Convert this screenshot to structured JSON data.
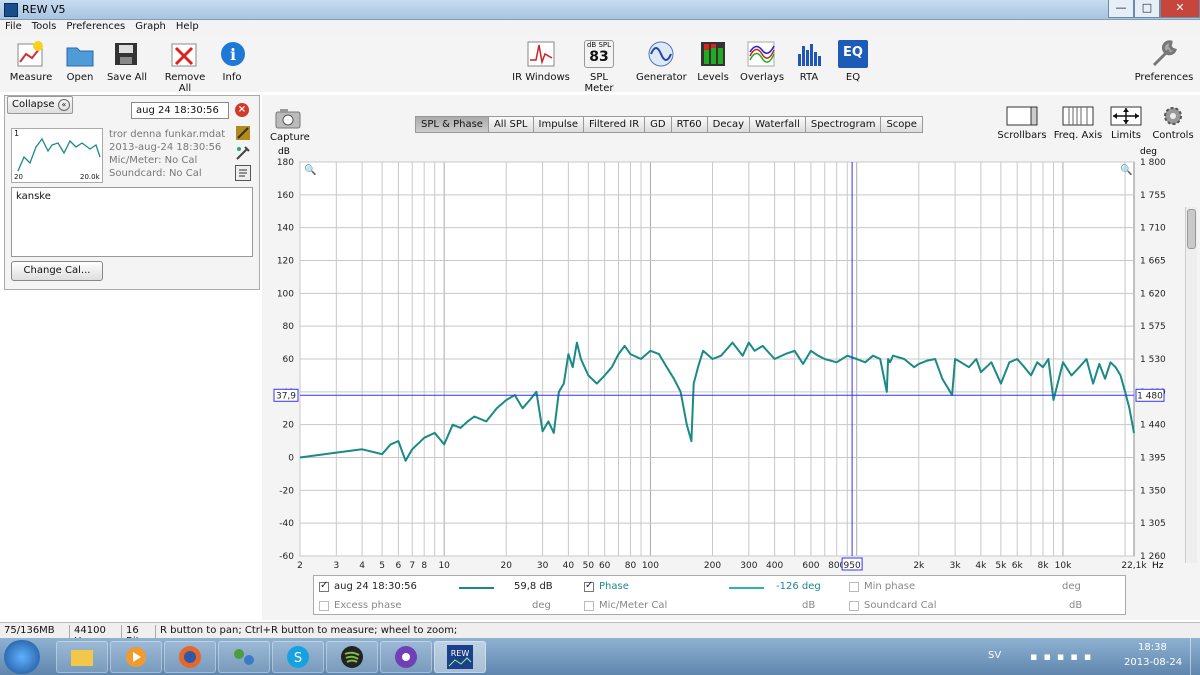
{
  "window": {
    "title": "REW V5",
    "controls": [
      "—",
      "□",
      "✕"
    ]
  },
  "menu": [
    "File",
    "Tools",
    "Preferences",
    "Graph",
    "Help"
  ],
  "toolbar_left": [
    "Measure",
    "Open",
    "Save All",
    "Remove All",
    "Info"
  ],
  "toolbar_mid": [
    "IR Windows",
    "SPL Meter",
    "Generator",
    "Levels",
    "Overlays",
    "RTA",
    "EQ"
  ],
  "spl_badge": {
    "top": "dB SPL",
    "value": "83"
  },
  "toolbar_right": "Preferences",
  "left_panel": {
    "collapse_label": "Collapse",
    "measurement_name": "aug 24 18:30:56",
    "thumb_index": "1",
    "thumb_left": "20",
    "thumb_right": "20.0k",
    "file": "tror denna funkar.mdat",
    "date": "2013-aug-24 18:30:56",
    "mic": "Mic/Meter: No Cal",
    "soundcard": "Soundcard: No Cal",
    "notes": "kanske",
    "change_cal": "Change Cal..."
  },
  "capture_label": "Capture",
  "tabs": [
    "SPL & Phase",
    "All SPL",
    "Impulse",
    "Filtered IR",
    "GD",
    "RT60",
    "Decay",
    "Waterfall",
    "Spectrogram",
    "Scope"
  ],
  "active_tab": 0,
  "right_controls": [
    "Scrollbars",
    "Freq. Axis",
    "Limits",
    "Controls"
  ],
  "legend": {
    "row1": [
      {
        "label": "aug 24 18:30:56",
        "value": "59,8 dB",
        "checked": true
      },
      {
        "label": "Phase",
        "value": "-126 deg",
        "checked": true
      },
      {
        "label": "Min phase",
        "value": "deg",
        "checked": false
      }
    ],
    "row2": [
      {
        "label": "Excess phase",
        "value": "deg",
        "checked": false
      },
      {
        "label": "Mic/Meter Cal",
        "value": "dB",
        "checked": false
      },
      {
        "label": "Soundcard Cal",
        "value": "dB",
        "checked": false
      }
    ]
  },
  "status": [
    "75/136MB",
    "44100 Hz",
    "16 Bit",
    "R button to pan; Ctrl+R button to measure; wheel to zoom;"
  ],
  "taskbar": {
    "lang": "SV",
    "time": "18:38",
    "date": "2013-08-24"
  },
  "colors": {
    "trace": "#1a8a87",
    "cursor": "#3333ff",
    "grid": "#c8c8c8"
  },
  "chart_data": {
    "type": "line",
    "xscale": "log",
    "xlim": [
      2,
      22100
    ],
    "ylim": [
      -60,
      180
    ],
    "y2lim": [
      1260,
      1800
    ],
    "ylabel": "dB",
    "y2label": "deg",
    "xunit": "Hz",
    "yticks": [
      180,
      160,
      140,
      120,
      100,
      80,
      60,
      40,
      20,
      0,
      -20,
      -40,
      -60
    ],
    "y2ticks": [
      "1 800",
      "1 755",
      "1 710",
      "1 665",
      "1 620",
      "1 575",
      "1 530",
      "1 480",
      "1 440",
      "1 395",
      "1 350",
      "1 305",
      "1 260"
    ],
    "xticks": [
      {
        "v": 2,
        "t": "2"
      },
      {
        "v": 3,
        "t": "3"
      },
      {
        "v": 4,
        "t": "4"
      },
      {
        "v": 5,
        "t": "5"
      },
      {
        "v": 6,
        "t": "6"
      },
      {
        "v": 7,
        "t": "7"
      },
      {
        "v": 8,
        "t": "8"
      },
      {
        "v": 10,
        "t": "10"
      },
      {
        "v": 20,
        "t": "20"
      },
      {
        "v": 30,
        "t": "30"
      },
      {
        "v": 40,
        "t": "40"
      },
      {
        "v": 50,
        "t": "50"
      },
      {
        "v": 60,
        "t": "60"
      },
      {
        "v": 80,
        "t": "80"
      },
      {
        "v": 100,
        "t": "100"
      },
      {
        "v": 200,
        "t": "200"
      },
      {
        "v": 300,
        "t": "300"
      },
      {
        "v": 400,
        "t": "400"
      },
      {
        "v": 600,
        "t": "600"
      },
      {
        "v": 800,
        "t": "800"
      },
      {
        "v": 2000,
        "t": "2k"
      },
      {
        "v": 3000,
        "t": "3k"
      },
      {
        "v": 4000,
        "t": "4k"
      },
      {
        "v": 5000,
        "t": "5k"
      },
      {
        "v": 6000,
        "t": "6k"
      },
      {
        "v": 8000,
        "t": "8k"
      },
      {
        "v": 10000,
        "t": "10k"
      },
      {
        "v": 22100,
        "t": "22,1k"
      }
    ],
    "cursor": {
      "x": 950,
      "x_label": "950",
      "y": 37.9,
      "y_label": "37,9",
      "y2_label": "1 480"
    },
    "series": [
      {
        "name": "aug 24 18:30:56",
        "x": [
          2,
          3,
          4,
          5,
          5.5,
          6,
          6.5,
          7,
          8,
          9,
          10,
          11,
          12,
          13,
          14,
          16,
          18,
          20,
          22,
          24,
          26,
          28,
          30,
          32,
          34,
          36,
          38,
          40,
          42,
          44,
          46,
          50,
          55,
          60,
          65,
          70,
          75,
          80,
          90,
          100,
          110,
          120,
          130,
          140,
          150,
          158,
          162,
          170,
          180,
          200,
          220,
          250,
          280,
          300,
          320,
          350,
          400,
          450,
          500,
          550,
          600,
          650,
          700,
          800,
          900,
          1000,
          1100,
          1200,
          1300,
          1400,
          1420,
          1450,
          1500,
          1700,
          1900,
          2000,
          2200,
          2400,
          2600,
          2900,
          3000,
          3200,
          3500,
          3800,
          4000,
          4500,
          5000,
          5500,
          6000,
          6500,
          7000,
          7500,
          8000,
          8500,
          9000,
          10000,
          11000,
          12000,
          13000,
          14000,
          15000,
          16000,
          17000,
          18000,
          19000,
          20000,
          21000,
          22100
        ],
        "y": [
          0,
          3,
          5,
          2,
          8,
          10,
          -2,
          5,
          12,
          15,
          8,
          20,
          18,
          22,
          25,
          22,
          30,
          35,
          38,
          30,
          35,
          40,
          16,
          22,
          15,
          40,
          45,
          63,
          55,
          70,
          60,
          50,
          45,
          50,
          55,
          63,
          68,
          63,
          60,
          65,
          63,
          55,
          48,
          40,
          20,
          10,
          45,
          55,
          65,
          60,
          62,
          70,
          62,
          70,
          65,
          68,
          60,
          63,
          65,
          57,
          65,
          62,
          60,
          58,
          62,
          60,
          58,
          62,
          60,
          40,
          60,
          58,
          62,
          60,
          55,
          57,
          59,
          60,
          48,
          38,
          60,
          58,
          55,
          60,
          52,
          58,
          45,
          58,
          60,
          55,
          50,
          58,
          55,
          60,
          35,
          58,
          50,
          55,
          60,
          45,
          57,
          48,
          58,
          55,
          50,
          40,
          30,
          15
        ]
      }
    ]
  }
}
